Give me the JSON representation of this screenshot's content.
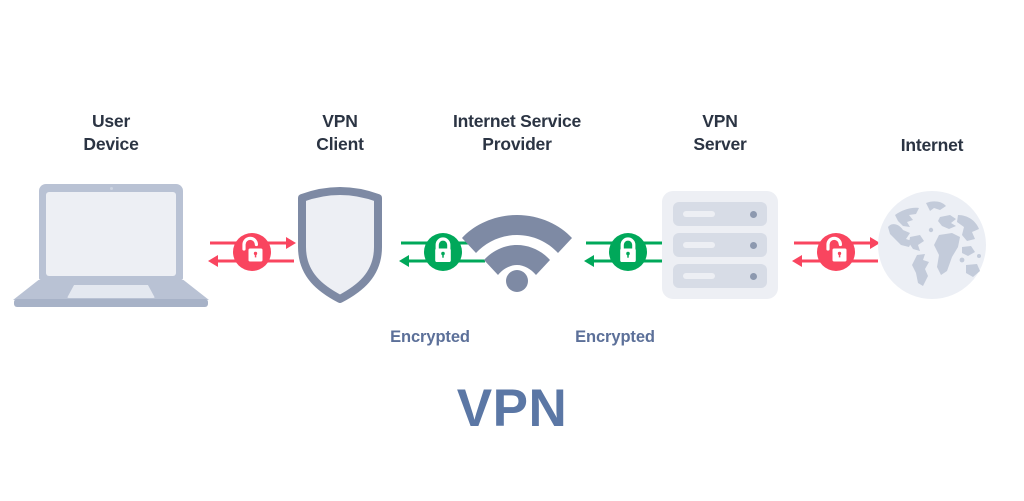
{
  "diagram": {
    "title": "VPN",
    "title_color": "#5b77a5",
    "label_color": "#2b3443",
    "encrypted_color": "#5c7099",
    "secure_color": "#00a85a",
    "insecure_color": "#f9455f",
    "nodes": [
      {
        "id": "user-device",
        "label": "User\nDevice",
        "icon": "laptop-icon"
      },
      {
        "id": "vpn-client",
        "label": "VPN\nClient",
        "icon": "shield-icon"
      },
      {
        "id": "isp",
        "label": "Internet Service\nProvider",
        "icon": "wifi-icon"
      },
      {
        "id": "vpn-server",
        "label": "VPN\nServer",
        "icon": "server-icon"
      },
      {
        "id": "internet",
        "label": "Internet",
        "icon": "globe-icon"
      }
    ],
    "connectors": [
      {
        "id": "user-to-client",
        "state": "unencrypted",
        "icon": "unlocked-padlock-icon",
        "color": "#f9455f"
      },
      {
        "id": "client-to-isp",
        "state": "encrypted",
        "icon": "locked-padlock-icon",
        "color": "#00a85a"
      },
      {
        "id": "isp-to-server",
        "state": "encrypted",
        "icon": "locked-padlock-icon",
        "color": "#00a85a"
      },
      {
        "id": "server-to-internet",
        "state": "unencrypted",
        "icon": "unlocked-padlock-icon",
        "color": "#f9455f"
      }
    ],
    "encrypted_labels": [
      {
        "id": "encrypted-client-isp",
        "text": "Encrypted"
      },
      {
        "id": "encrypted-isp-server",
        "text": "Encrypted"
      }
    ]
  }
}
